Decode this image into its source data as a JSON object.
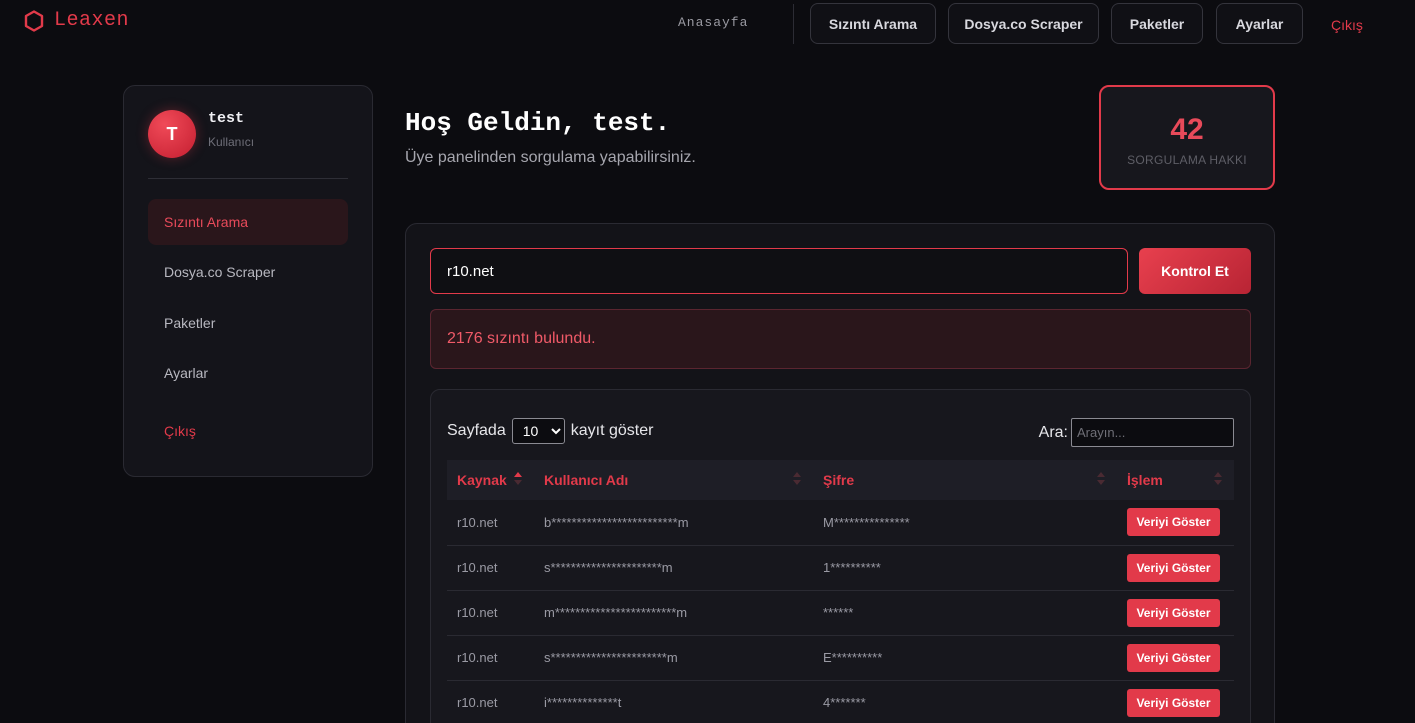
{
  "brand": {
    "name": "Leaxen",
    "icon": "hexagon-icon"
  },
  "nav": {
    "home": "Anasayfa",
    "buttons": [
      "Sızıntı Arama",
      "Dosya.co Scraper",
      "Paketler",
      "Ayarlar"
    ],
    "logout": "Çıkış"
  },
  "user": {
    "initial": "T",
    "name": "test",
    "role": "Kullanıcı"
  },
  "sidebar": {
    "items": [
      {
        "label": "Sızıntı Arama",
        "active": true
      },
      {
        "label": "Dosya.co Scraper",
        "active": false
      },
      {
        "label": "Paketler",
        "active": false
      },
      {
        "label": "Ayarlar",
        "active": false
      }
    ],
    "logout": "Çıkış"
  },
  "header": {
    "welcome": "Hoş Geldin, test.",
    "subtitle": "Üye panelinden sorgulama yapabilirsiniz."
  },
  "credits": {
    "value": "42",
    "label": "SORGULAMA HAKKI"
  },
  "search": {
    "value": "r10.net",
    "button": "Kontrol Et"
  },
  "alert": {
    "message": "2176 sızıntı bulundu."
  },
  "table": {
    "length_prefix": "Sayfada",
    "length_value": "10",
    "length_suffix": "kayıt göster",
    "filter_label": "Ara:",
    "filter_placeholder": "Arayın...",
    "columns": [
      "Kaynak",
      "Kullanıcı Adı",
      "Şifre",
      "İşlem"
    ],
    "rows": [
      [
        "r10.net",
        "b*************************m",
        "M***************",
        "Veriyi Göster"
      ],
      [
        "r10.net",
        "s**********************m",
        "1**********",
        "Veriyi Göster"
      ],
      [
        "r10.net",
        "m************************m",
        "******",
        "Veriyi Göster"
      ],
      [
        "r10.net",
        "s***********************m",
        "E**********",
        "Veriyi Göster"
      ],
      [
        "r10.net",
        "i**************t",
        "4*******",
        "Veriyi Göster"
      ]
    ]
  },
  "colors": {
    "accent": "#e23a4a",
    "background": "#0c0c10",
    "panel": "#131318"
  }
}
